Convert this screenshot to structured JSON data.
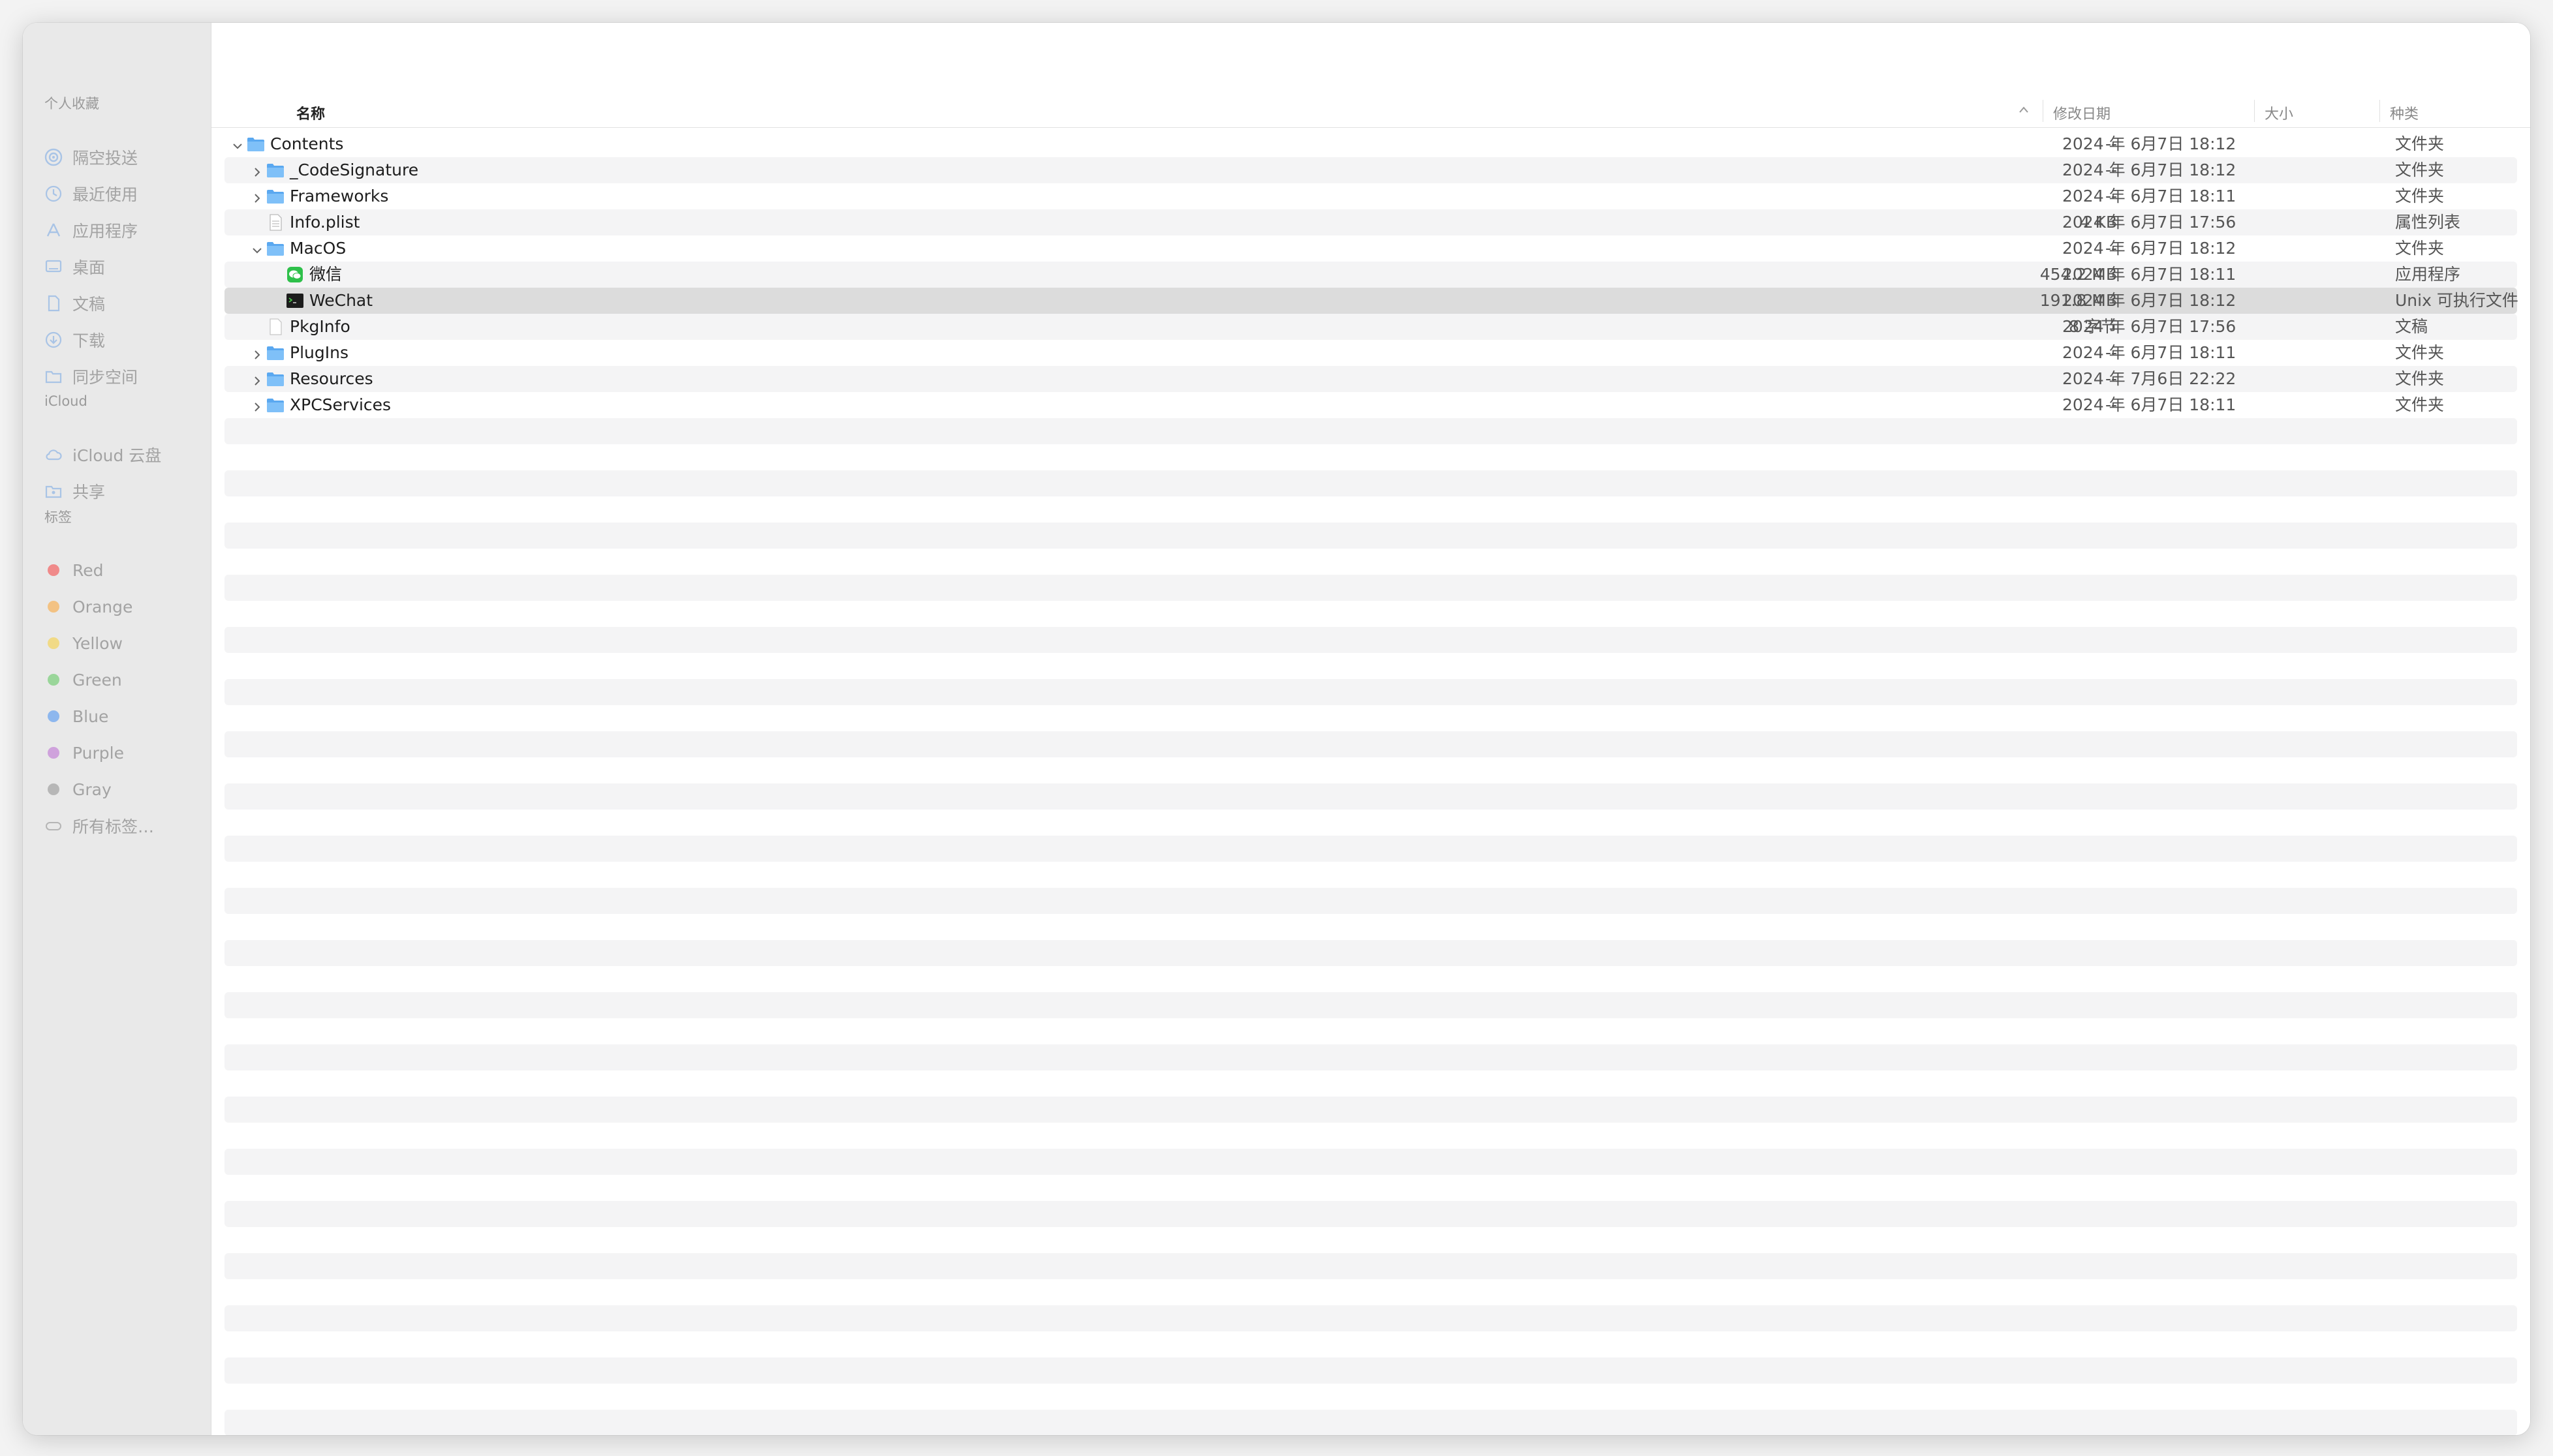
{
  "sidebar": {
    "favorites_title": "个人收藏",
    "favorites": [
      {
        "label": "隔空投送",
        "icon": "airdrop-icon"
      },
      {
        "label": "最近使用",
        "icon": "clock-icon"
      },
      {
        "label": "应用程序",
        "icon": "applications-icon"
      },
      {
        "label": "桌面",
        "icon": "desktop-icon"
      },
      {
        "label": "文稿",
        "icon": "document-icon"
      },
      {
        "label": "下载",
        "icon": "download-icon"
      },
      {
        "label": "同步空间",
        "icon": "folder-icon"
      }
    ],
    "icloud_title": "iCloud",
    "icloud": [
      {
        "label": "iCloud 云盘",
        "icon": "cloud-icon"
      },
      {
        "label": "共享",
        "icon": "shared-folder-icon"
      }
    ],
    "tags_title": "标签",
    "tags": [
      {
        "label": "Red",
        "color": "#f08a8a"
      },
      {
        "label": "Orange",
        "color": "#f3c283"
      },
      {
        "label": "Yellow",
        "color": "#f1da86"
      },
      {
        "label": "Green",
        "color": "#9ad69a"
      },
      {
        "label": "Blue",
        "color": "#8db7ee"
      },
      {
        "label": "Purple",
        "color": "#cfa2dc"
      },
      {
        "label": "Gray",
        "color": "#b7b7b7"
      },
      {
        "label": "所有标签…",
        "color": ""
      }
    ]
  },
  "columns": {
    "name": "名称",
    "date": "修改日期",
    "size": "大小",
    "kind": "种类"
  },
  "files": [
    {
      "name": "Contents",
      "date": "2024 年 6月7日 18:12",
      "size": "--",
      "kind": "文件夹",
      "icon": "folder-icon",
      "disclosure": "expanded",
      "depth": 0
    },
    {
      "name": "_CodeSignature",
      "date": "2024 年 6月7日 18:12",
      "size": "--",
      "kind": "文件夹",
      "icon": "folder-icon",
      "disclosure": "collapsed",
      "depth": 1
    },
    {
      "name": "Frameworks",
      "date": "2024 年 6月7日 18:11",
      "size": "--",
      "kind": "文件夹",
      "icon": "folder-icon",
      "disclosure": "collapsed",
      "depth": 1
    },
    {
      "name": "Info.plist",
      "date": "2024 年 6月7日 17:56",
      "size": "4 KB",
      "kind": "属性列表",
      "icon": "plist-file-icon",
      "disclosure": "none",
      "depth": 1
    },
    {
      "name": "MacOS",
      "date": "2024 年 6月7日 18:12",
      "size": "--",
      "kind": "文件夹",
      "icon": "folder-icon",
      "disclosure": "expanded",
      "depth": 1
    },
    {
      "name": "微信",
      "date": "2024 年 6月7日 18:11",
      "size": "454.2 MB",
      "kind": "应用程序",
      "icon": "wechat-app-icon",
      "disclosure": "none",
      "depth": 2
    },
    {
      "name": "WeChat",
      "date": "2024 年 6月7日 18:12",
      "size": "191.8 MB",
      "kind": "Unix 可执行文件",
      "icon": "terminal-exec-icon",
      "disclosure": "none",
      "depth": 2,
      "selected": true
    },
    {
      "name": "PkgInfo",
      "date": "2024 年 6月7日 17:56",
      "size": "8 字节",
      "kind": "文稿",
      "icon": "blank-file-icon",
      "disclosure": "none",
      "depth": 1
    },
    {
      "name": "PlugIns",
      "date": "2024 年 6月7日 18:11",
      "size": "--",
      "kind": "文件夹",
      "icon": "folder-icon",
      "disclosure": "collapsed",
      "depth": 1
    },
    {
      "name": "Resources",
      "date": "2024 年 7月6日 22:22",
      "size": "--",
      "kind": "文件夹",
      "icon": "folder-icon",
      "disclosure": "collapsed",
      "depth": 1
    },
    {
      "name": "XPCServices",
      "date": "2024 年 6月7日 18:11",
      "size": "--",
      "kind": "文件夹",
      "icon": "folder-icon",
      "disclosure": "collapsed",
      "depth": 1
    }
  ]
}
